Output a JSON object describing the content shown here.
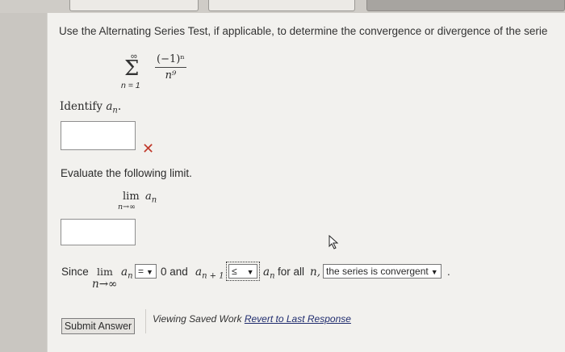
{
  "question": {
    "text": "Use the Alternating Series Test, if applicable, to determine the convergence or divergence of the serie"
  },
  "series": {
    "sigma": "Σ",
    "upper": "∞",
    "lower": "n = 1",
    "numerator": "(−1)ⁿ",
    "denominator": "n⁹"
  },
  "identify": {
    "label": "Identify",
    "var": "a",
    "sub": "n",
    "punct": ".",
    "answer_value": ""
  },
  "feedback": {
    "wrong_mark": "✕"
  },
  "evaluate": {
    "label": "Evaluate the following limit.",
    "lim": "lim",
    "lim_sub": "n→∞",
    "var": "a",
    "sub": "n",
    "answer_value": ""
  },
  "since": {
    "since_word": "Since",
    "lim": "lim",
    "lim_sub": "n→∞",
    "var": "a",
    "sub": "n",
    "eq_select": "=",
    "zero_and": "0 and",
    "a_var": "a",
    "a_sub": "n + 1",
    "cmp_select": "≤",
    "a2_var": "a",
    "a2_sub": "n",
    "for_all": "for all",
    "n_var": "n,",
    "conclusion_select": "the series is convergent",
    "end_dot": "."
  },
  "actions": {
    "submit_label": "Submit Answer",
    "viewing_text": "Viewing Saved Work",
    "revert_link": "Revert to Last Response"
  }
}
